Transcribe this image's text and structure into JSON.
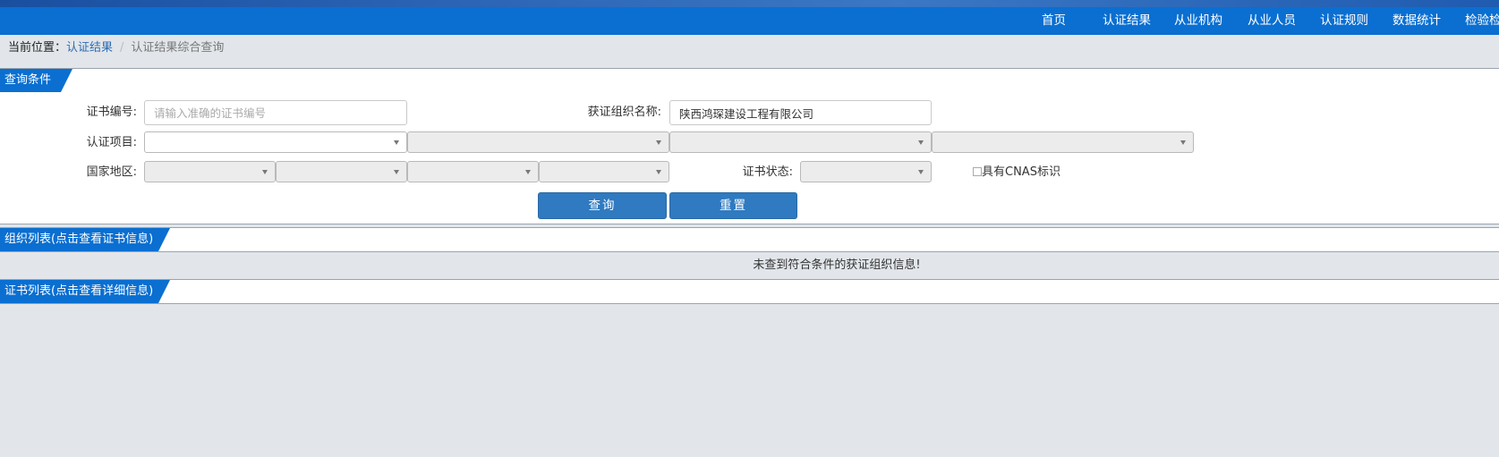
{
  "nav": {
    "items": [
      "首页",
      "认证结果",
      "从业机构",
      "从业人员",
      "认证规则",
      "数据统计",
      "检验检"
    ]
  },
  "breadcrumb": {
    "prefix": "当前位置：",
    "link": "认证结果",
    "separator": "/",
    "current": "认证结果综合查询"
  },
  "query": {
    "title": "查询条件",
    "cert_no_label": "证书编号:",
    "cert_no_placeholder": "请输入准确的证书编号",
    "org_name_label": "获证组织名称:",
    "org_name_value": "陕西鸿琛建设工程有限公司",
    "cert_item_label": "认证项目:",
    "region_label": "国家地区:",
    "status_label": "证书状态:",
    "cnas_label": "具有CNAS标识",
    "search_button": "查询",
    "reset_button": "重置"
  },
  "org_list": {
    "title": "组织列表(点击查看证书信息)",
    "empty_message": "未查到符合条件的获证组织信息!"
  },
  "cert_list": {
    "title": "证书列表(点击查看详细信息)"
  },
  "colors": {
    "nav_bg": "#0a6fd1",
    "button_bg": "#2f7ac0",
    "page_bg": "#e2e6ea",
    "link": "#2f6db5"
  }
}
